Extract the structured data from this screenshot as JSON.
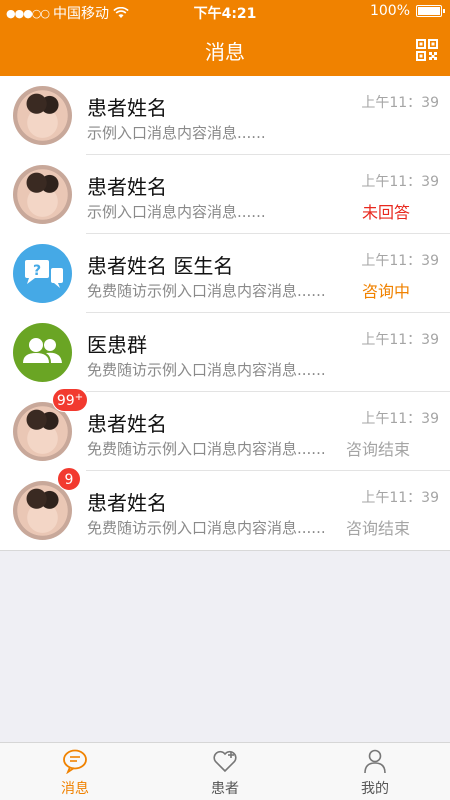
{
  "status_bar": {
    "signal_dots": "●●●○○",
    "carrier": "中国移动",
    "time": "下午4:21",
    "battery": "100%",
    "battery_level": 1.0
  },
  "nav": {
    "title": "消息",
    "qr_icon": "qr-code-icon"
  },
  "messages": [
    {
      "title": "患者姓名",
      "preview": "示例入口消息内容消息......",
      "time": "上午11：39",
      "status": "",
      "avatar": "photo",
      "badge": ""
    },
    {
      "title": "患者姓名",
      "preview": "示例入口消息内容消息......",
      "time": "上午11：39",
      "status": "未回答",
      "status_color": "#e8281e",
      "avatar": "photo",
      "badge": ""
    },
    {
      "title": "患者姓名 医生名",
      "preview": "免费随访示例入口消息内容消息......",
      "time": "上午11：39",
      "status": "咨询中",
      "status_color": "#f08200",
      "avatar": "consult-icon",
      "badge": ""
    },
    {
      "title": "医患群",
      "preview": "免费随访示例入口消息内容消息......",
      "time": "上午11：39",
      "status": "",
      "avatar": "group-icon",
      "badge": ""
    },
    {
      "title": "患者姓名",
      "preview": "免费随访示例入口消息内容消息......",
      "time": "上午11：39",
      "status": "咨询结束",
      "status_color": "#a5a5a5",
      "avatar": "photo",
      "badge": "99+"
    },
    {
      "title": "患者姓名",
      "preview": "免费随访示例入口消息内容消息......",
      "time": "上午11：39",
      "status": "咨询结束",
      "status_color": "#a5a5a5",
      "avatar": "photo",
      "badge": "9"
    }
  ],
  "tabs": [
    {
      "label": "消息",
      "icon": "chat-bubble-icon",
      "active": true
    },
    {
      "label": "患者",
      "icon": "heart-plus-icon",
      "active": false
    },
    {
      "label": "我的",
      "icon": "person-icon",
      "active": false
    }
  ],
  "colors": {
    "brand": "#f08200",
    "unanswered": "#e8281e",
    "badge": "#f23a2f"
  }
}
